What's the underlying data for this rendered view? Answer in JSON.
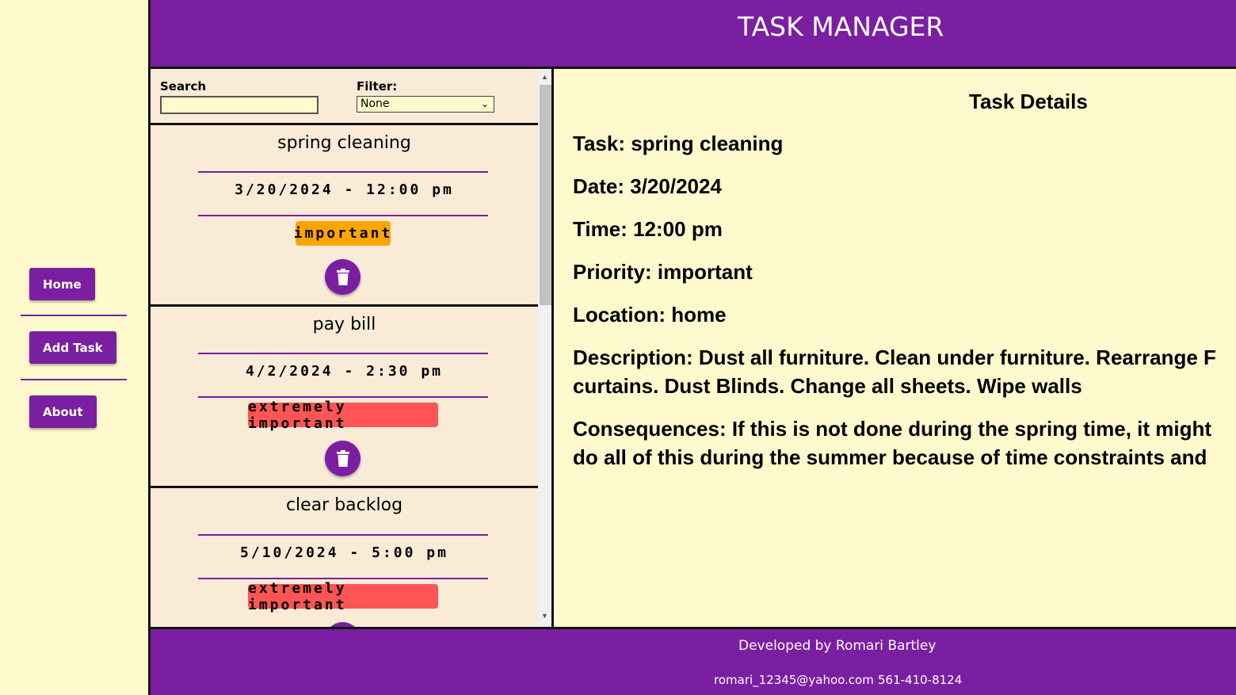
{
  "nav": {
    "items": [
      {
        "label": "Home"
      },
      {
        "label": "Add Task"
      },
      {
        "label": "About"
      }
    ]
  },
  "header": {
    "title": "TASK MANAGER"
  },
  "controls": {
    "search_label": "Search",
    "search_value": "",
    "filter_label": "Filter:",
    "filter_selected": "None"
  },
  "tasks": [
    {
      "name": "spring cleaning",
      "date": "3/20/2024 - 12:00 pm",
      "priority": "important",
      "priority_color": "#ffa500"
    },
    {
      "name": "pay bill",
      "date": "4/2/2024 - 2:30 pm",
      "priority": "extremely important",
      "priority_color": "#ff5555"
    },
    {
      "name": "clear backlog",
      "date": "5/10/2024 - 5:00 pm",
      "priority": "extremely important",
      "priority_color": "#ff5555"
    }
  ],
  "details": {
    "heading": "Task Details",
    "task": "Task: spring cleaning",
    "date": "Date: 3/20/2024",
    "time": "Time: 12:00 pm",
    "priority": "Priority: important",
    "location": "Location: home",
    "description_line1": "Description: Dust all furniture. Clean under furniture. Rearrange F",
    "description_line2": "curtains. Dust Blinds. Change all sheets. Wipe walls",
    "consequences_line1": "Consequences: If this is not done during the spring time, it might",
    "consequences_line2": "do all of this during the summer because of time constraints and"
  },
  "footer": {
    "credit": "Developed by Romari Bartley",
    "email": "romari_12345@yahoo.com",
    "phone": "561-410-8124"
  },
  "colors": {
    "accent": "#7a1fa2",
    "background": "#fffacd",
    "card_background": "#faebd7"
  }
}
